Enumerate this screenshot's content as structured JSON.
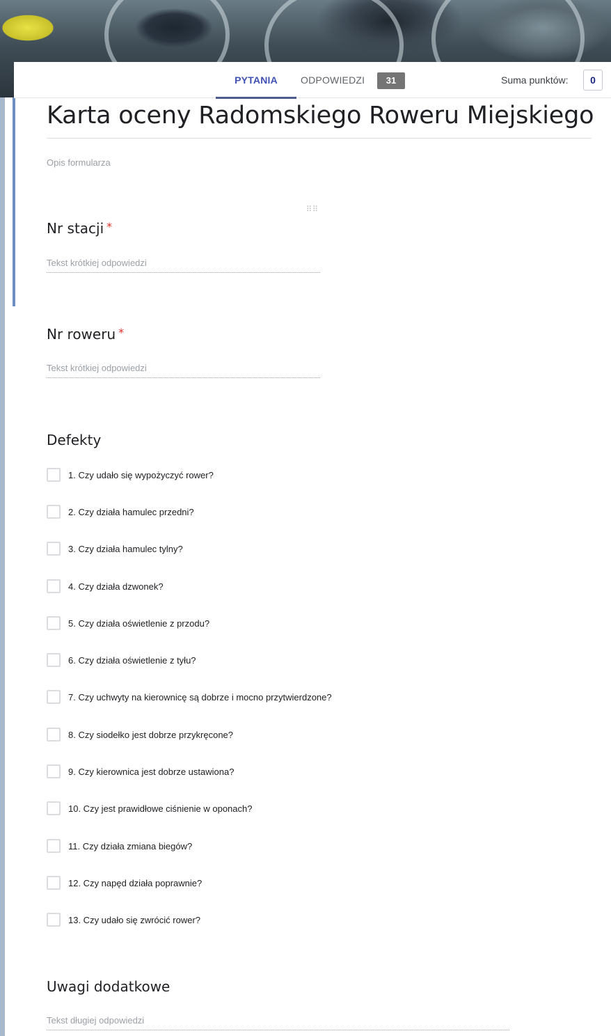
{
  "tabs": {
    "questions": "PYTANIA",
    "answers": "ODPOWIEDZI",
    "answers_count": "31",
    "points_label": "Suma punktów:",
    "points_value": "0"
  },
  "form": {
    "title": "Karta oceny Radomskiego Roweru Miejskiego",
    "description": "Opis formularza"
  },
  "questions": {
    "station": {
      "title": "Nr stacji",
      "required_mark": "*",
      "placeholder": "Tekst krótkiej odpowiedzi"
    },
    "bike": {
      "title": "Nr roweru",
      "required_mark": "*",
      "placeholder": "Tekst krótkiej odpowiedzi"
    },
    "defects": {
      "title": "Defekty",
      "options": [
        "1. Czy udało się wypożyczyć rower?",
        "2. Czy działa hamulec przedni?",
        "3. Czy działa hamulec tylny?",
        "4. Czy działa dzwonek?",
        "5. Czy działa oświetlenie z przodu?",
        "6. Czy działa oświetlenie z tyłu?",
        "7. Czy uchwyty na kierownicę są dobrze i mocno przytwierdzone?",
        "8. Czy siodełko jest dobrze przykręcone?",
        "9. Czy kierownica jest dobrze ustawiona?",
        "10. Czy jest prawidłowe ciśnienie w oponach?",
        "11. Czy działa zmiana biegów?",
        "12. Czy napęd działa poprawnie?",
        "13. Czy udało się zwrócić rower?"
      ]
    },
    "notes": {
      "title": "Uwagi dodatkowe",
      "placeholder": "Tekst długiej odpowiedzi"
    }
  },
  "colors": {
    "accent": "#3f51b5",
    "required": "#d93025",
    "badge": "#757575"
  }
}
